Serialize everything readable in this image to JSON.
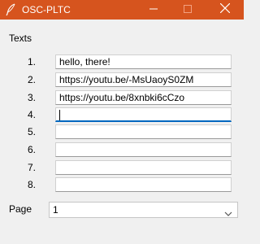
{
  "window": {
    "title": "OSC-PLTC",
    "icon": "feather-icon",
    "accent_color": "#d6541e"
  },
  "titlebar_controls": [
    "minimize-icon",
    "maximize-icon",
    "close-icon"
  ],
  "texts_section": {
    "label": "Texts",
    "rows": [
      {
        "number": "1.",
        "value": "hello, there!"
      },
      {
        "number": "2.",
        "value": "https://youtu.be/-MsUaoyS0ZM"
      },
      {
        "number": "3.",
        "value": "https://youtu.be/8xnbki6cCzo"
      },
      {
        "number": "4.",
        "value": ""
      },
      {
        "number": "5.",
        "value": ""
      },
      {
        "number": "6.",
        "value": ""
      },
      {
        "number": "7.",
        "value": ""
      },
      {
        "number": "8.",
        "value": ""
      }
    ]
  },
  "page": {
    "label": "Page",
    "selected": "1"
  }
}
